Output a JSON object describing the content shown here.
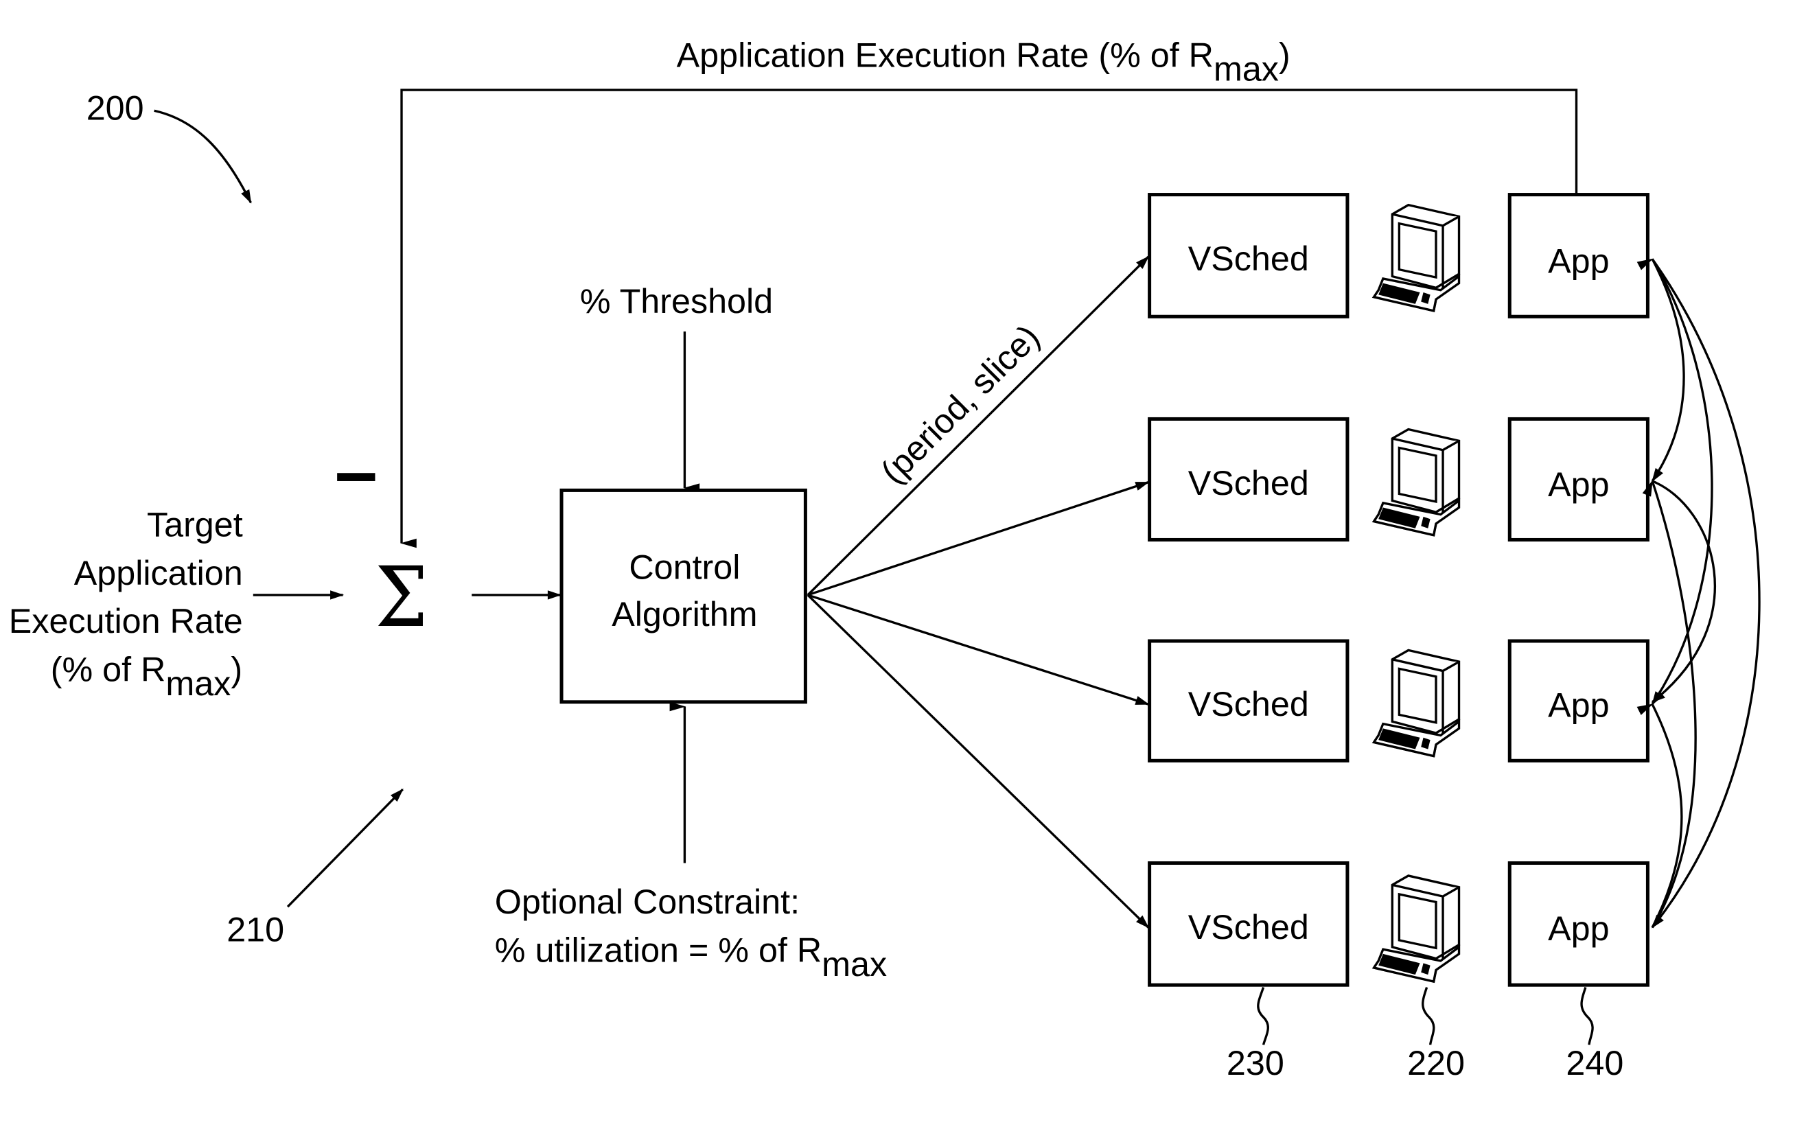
{
  "figure_number": "200",
  "feedback_label": {
    "text": "Application Execution Rate (% of R",
    "subscript": "max",
    "close": ")"
  },
  "input_label": {
    "lines": [
      "Target",
      "Application",
      "Execution Rate"
    ],
    "last_line": "(% of R",
    "subscript": "max",
    "close": ")"
  },
  "minus_sign": "—",
  "summation_symbol": "Σ",
  "summation_ref": "210",
  "threshold_label": "% Threshold",
  "control_box": {
    "line1": "Control",
    "line2": "Algorithm"
  },
  "edge_label": "(period, slice)",
  "constraint_label": {
    "line1": "Optional Constraint:",
    "line2": "% utilization = % of R",
    "subscript": "max"
  },
  "nodes": [
    {
      "vsched": "VSched",
      "app": "App"
    },
    {
      "vsched": "VSched",
      "app": "App"
    },
    {
      "vsched": "VSched",
      "app": "App"
    },
    {
      "vsched": "VSched",
      "app": "App"
    }
  ],
  "refs": {
    "vsched": "230",
    "computer": "220",
    "app": "240"
  },
  "icons": {
    "computer": "desktop-computer-icon"
  }
}
